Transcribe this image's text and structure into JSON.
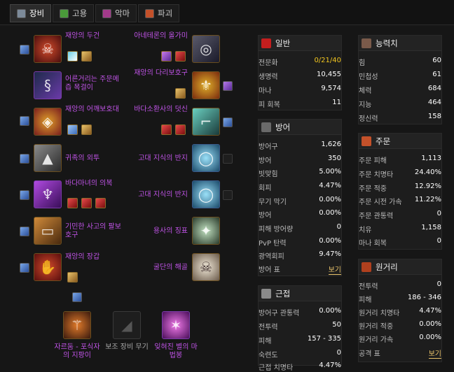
{
  "tabs": [
    {
      "label": "장비",
      "color": "#7c8a99"
    },
    {
      "label": "고용",
      "color": "#4a9a3a"
    },
    {
      "label": "악마",
      "color": "#a23a8a"
    },
    {
      "label": "파괴",
      "color": "#c4512a"
    }
  ],
  "gear": {
    "left": [
      {
        "name": "재앙의 두건",
        "icon": "skull-helm-icon",
        "color": "#8a1e1e"
      },
      {
        "name": "어른거리는 주문메 즙 목걸이",
        "icon": "necklace-icon",
        "color": "#3a2a6a"
      },
      {
        "name": "재앙의 어깨보호대",
        "icon": "shoulder-icon",
        "color": "#8a2a1e"
      },
      {
        "name": "귀족의 외투",
        "icon": "cloak-icon",
        "color": "#4a4a4a"
      },
      {
        "name": "바다마녀의 의복",
        "icon": "robe-icon",
        "color": "#6a2a8a"
      },
      {
        "name": "기민한 사고의 팔보 호구",
        "icon": "bracer-icon",
        "color": "#7a4a1e"
      },
      {
        "name": "재앙의 장갑",
        "icon": "gloves-icon",
        "color": "#8a2a1e"
      }
    ],
    "right": [
      {
        "name": "아네테론의 올가미",
        "icon": "belt-icon",
        "color": "#3a3a4a"
      },
      {
        "name": "재앙의 다리보호구",
        "icon": "legs-icon",
        "color": "#8a5a1e"
      },
      {
        "name": "바다소환사의 덧신",
        "icon": "boots-icon",
        "color": "#2a6a6a"
      },
      {
        "name": "고대 지식의 반지",
        "icon": "ring-icon",
        "color": "#3a6a8a"
      },
      {
        "name": "고대 지식의 반지",
        "icon": "ring-icon",
        "color": "#3a6a8a"
      },
      {
        "name": "용사의 징표",
        "icon": "trinket-icon",
        "color": "#5a6a5a"
      },
      {
        "name": "굴단의 해골",
        "icon": "skull-icon",
        "color": "#b0a898"
      }
    ],
    "weapons": [
      {
        "name": "자르둠 - 포식자의 지팡이",
        "icon": "staff-icon",
        "color": "#7a3a1e"
      },
      {
        "name": "보조 장비 무기",
        "icon": "empty-offhand-icon",
        "color": "#1e1e1e"
      },
      {
        "name": "잊혀진 별의 마법봉",
        "icon": "wand-icon",
        "color": "#a03ac0"
      }
    ]
  },
  "panels": {
    "general": {
      "title": "일반",
      "rows": [
        {
          "k": "전문화",
          "v": "0/21/40"
        },
        {
          "k": "생명력",
          "v": "10,455"
        },
        {
          "k": "마나",
          "v": "9,574"
        },
        {
          "k": "피 회복",
          "v": "11"
        }
      ]
    },
    "defense": {
      "title": "방어",
      "rows": [
        {
          "k": "방어구",
          "v": "1,626"
        },
        {
          "k": "방어",
          "v": "350"
        },
        {
          "k": "빗맞힘",
          "v": "5.00%"
        },
        {
          "k": "회피",
          "v": "4.47%"
        },
        {
          "k": "무기 막기",
          "v": "0.00%"
        },
        {
          "k": "방어",
          "v": "0.00%"
        },
        {
          "k": "피해 방어량",
          "v": "0"
        },
        {
          "k": "PvP 탄력",
          "v": "0.00%"
        },
        {
          "k": "광역회피",
          "v": "9.47%"
        },
        {
          "k": "방어 표",
          "v": "보기"
        }
      ]
    },
    "melee": {
      "title": "근접",
      "rows": [
        {
          "k": "방어구 관통력",
          "v": "0.00%"
        },
        {
          "k": "전투력",
          "v": "50"
        },
        {
          "k": "피해",
          "v": "157 - 335"
        },
        {
          "k": "숙련도",
          "v": "0"
        },
        {
          "k": "근접 치명타",
          "v": "4.47%"
        }
      ]
    },
    "stats": {
      "title": "능력치",
      "rows": [
        {
          "k": "힘",
          "v": "60"
        },
        {
          "k": "민첩성",
          "v": "61"
        },
        {
          "k": "체력",
          "v": "684"
        },
        {
          "k": "지능",
          "v": "464"
        },
        {
          "k": "정신력",
          "v": "158"
        }
      ]
    },
    "spell": {
      "title": "주문",
      "rows": [
        {
          "k": "주문 피해",
          "v": "1,113"
        },
        {
          "k": "주문 치명타",
          "v": "24.40%"
        },
        {
          "k": "주문 적중",
          "v": "12.92%"
        },
        {
          "k": "주문 시전 가속",
          "v": "11.22%"
        },
        {
          "k": "주문 관통력",
          "v": "0"
        },
        {
          "k": "치유",
          "v": "1,158"
        },
        {
          "k": "마나 회복",
          "v": "0"
        }
      ]
    },
    "ranged": {
      "title": "원거리",
      "rows": [
        {
          "k": "전투력",
          "v": "0"
        },
        {
          "k": "피해",
          "v": "186 - 346"
        },
        {
          "k": "원거리 치명타",
          "v": "4.47%"
        },
        {
          "k": "원거리 적중",
          "v": "0.00%"
        },
        {
          "k": "원거리 가속",
          "v": "0.00%"
        },
        {
          "k": "공격 표",
          "v": "보기"
        }
      ]
    }
  }
}
